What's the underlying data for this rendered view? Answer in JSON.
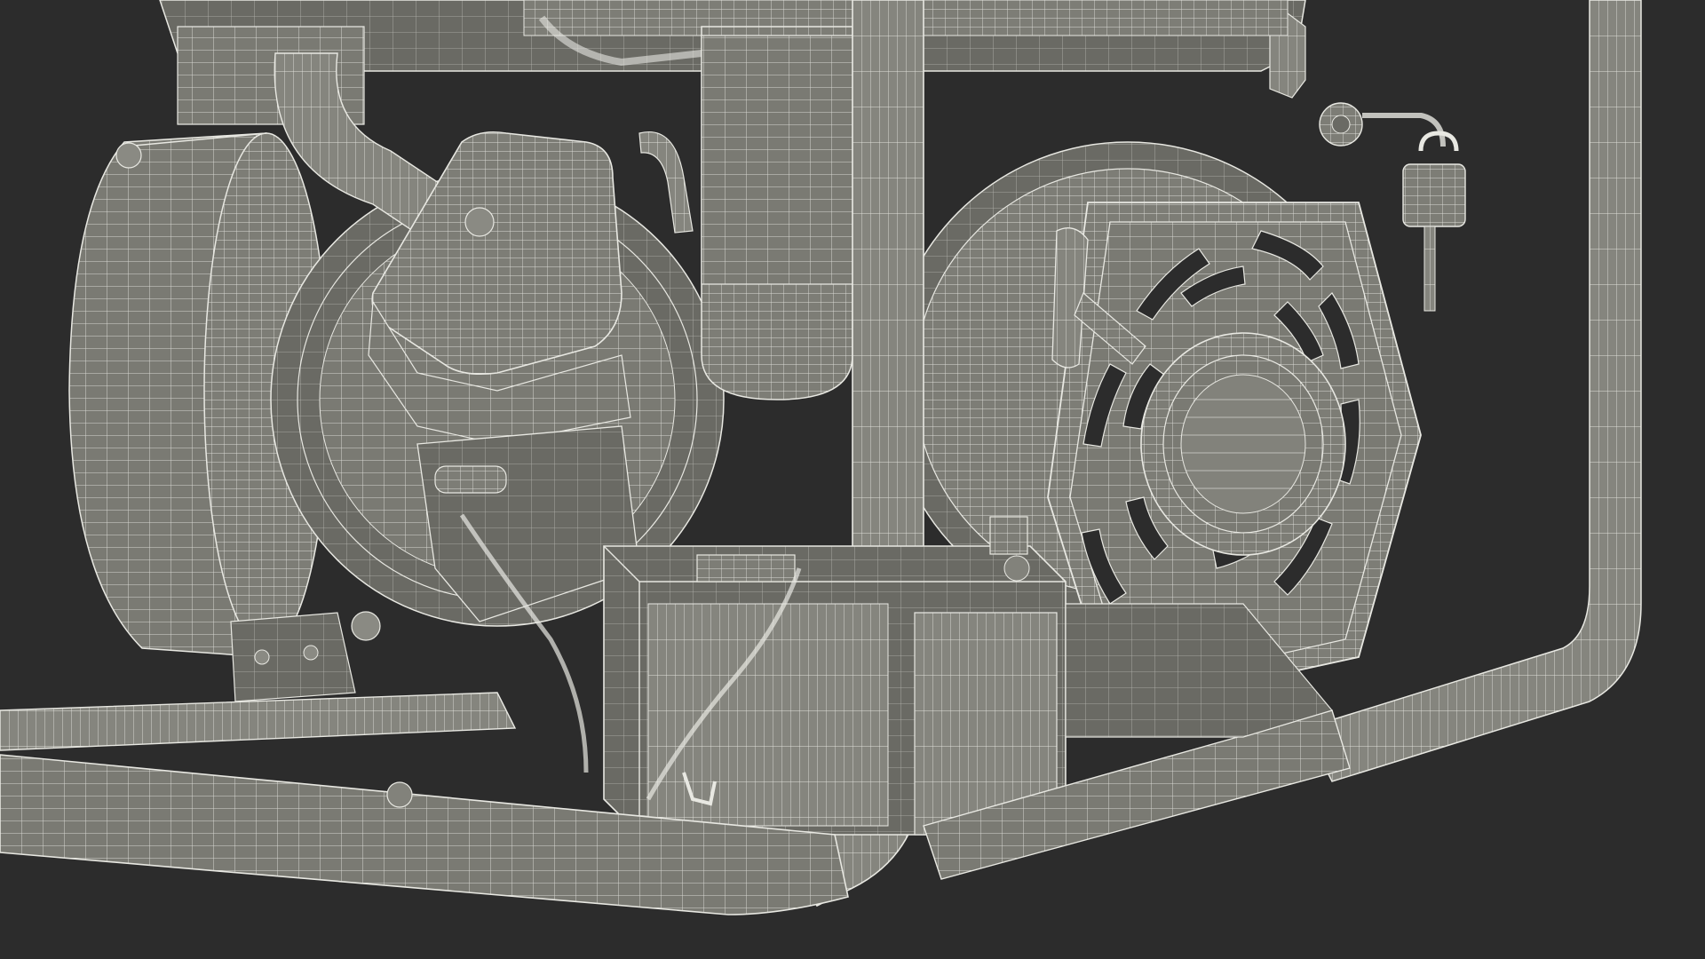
{
  "scene": {
    "subject": "wireframe-render-portable-generator-close-up",
    "background_color": "#2c2c2c",
    "model_fill_color": "#7a7a73",
    "model_fill_light": "#8e8e86",
    "model_fill_dark": "#5e5e58",
    "wire_color": "#e8e8e2",
    "text_labels": []
  }
}
